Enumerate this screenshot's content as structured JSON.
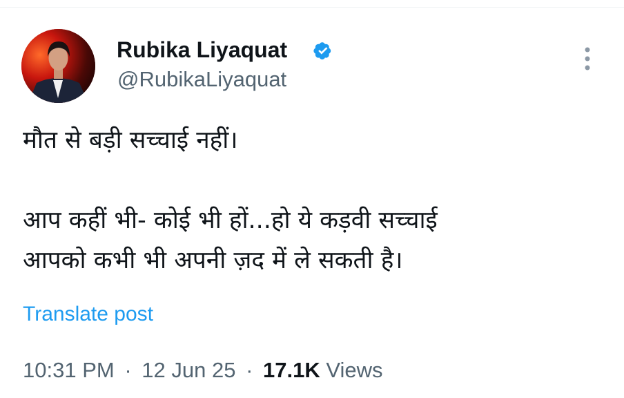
{
  "author": {
    "name": "Rubika Liyaquat",
    "handle": "@RubikaLiyaquat",
    "verified": true
  },
  "tweet": {
    "lines": [
      "मौत से बड़ी सच्चाई नहीं।",
      "आप कहीं भी- कोई भी हों...हो ये कड़वी सच्चाई",
      "आपको कभी भी अपनी ज़द में ले सकती है।"
    ],
    "translate_label": "Translate post"
  },
  "meta": {
    "time": "10:31 PM",
    "separator": "·",
    "date": "12 Jun 25",
    "views_count": "17.1K",
    "views_label": "Views"
  },
  "colors": {
    "text": "#0f1419",
    "secondary": "#536471",
    "link": "#1d9bf0",
    "verified": "#1d9bf0"
  },
  "icons": {
    "verified": "verified-badge-icon",
    "more": "more-vertical-icon"
  }
}
